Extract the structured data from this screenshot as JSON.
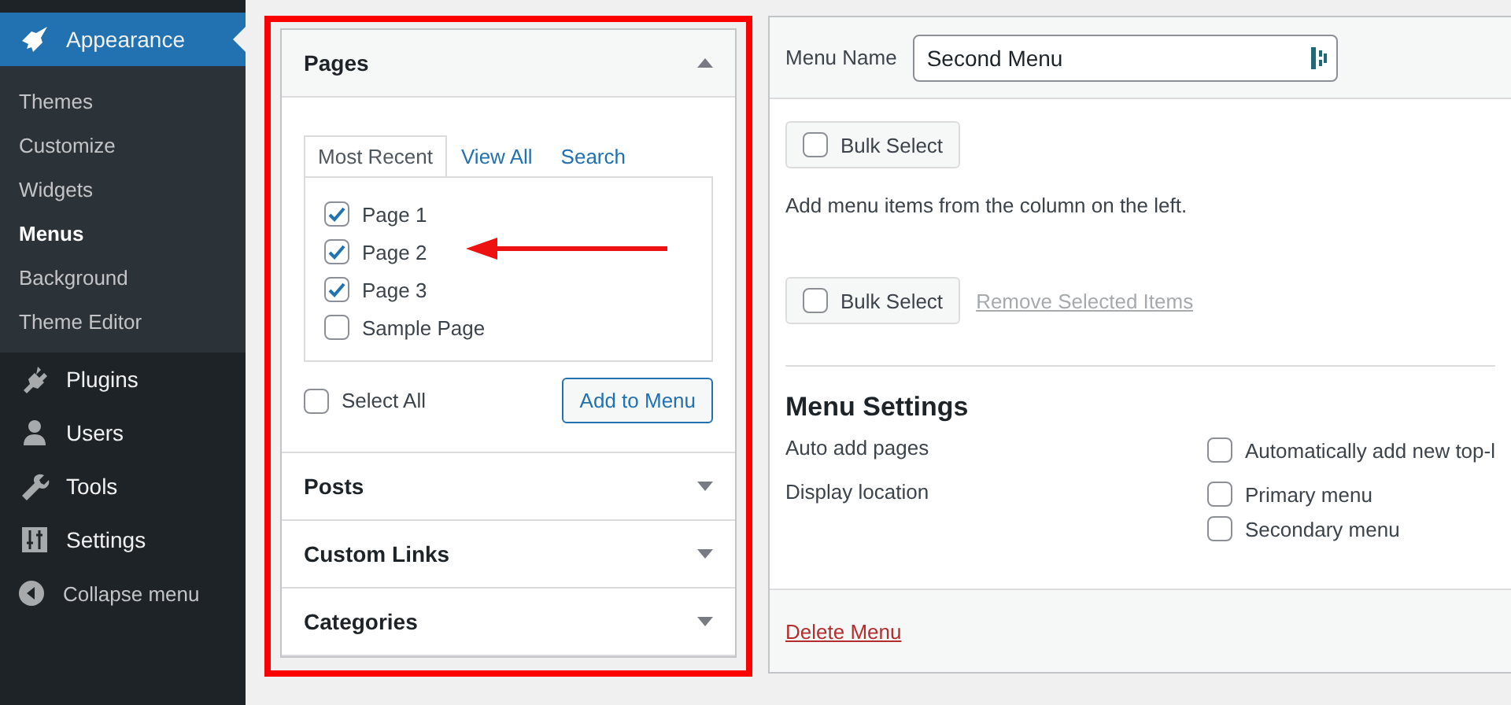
{
  "sidebar": {
    "items": [
      {
        "label": "Appearance",
        "selected": true,
        "children": [
          {
            "label": "Themes",
            "selected": false
          },
          {
            "label": "Customize",
            "selected": false
          },
          {
            "label": "Widgets",
            "selected": false
          },
          {
            "label": "Menus",
            "selected": true
          },
          {
            "label": "Background",
            "selected": false
          },
          {
            "label": "Theme Editor",
            "selected": false
          }
        ]
      },
      {
        "label": "Plugins",
        "selected": false
      },
      {
        "label": "Users",
        "selected": false
      },
      {
        "label": "Tools",
        "selected": false
      },
      {
        "label": "Settings",
        "selected": false
      }
    ],
    "collapse_label": "Collapse menu"
  },
  "sections": [
    {
      "title": "Pages",
      "expanded": true,
      "tabs": [
        {
          "label": "Most Recent",
          "selected": true
        },
        {
          "label": "View All",
          "selected": false
        },
        {
          "label": "Search",
          "selected": false
        }
      ],
      "items": [
        {
          "label": "Page 1",
          "checked": true
        },
        {
          "label": "Page 2",
          "checked": true
        },
        {
          "label": "Page 3",
          "checked": true
        },
        {
          "label": "Sample Page",
          "checked": false
        }
      ],
      "select_all": {
        "label": "Select All",
        "checked": false
      },
      "add_button": "Add to Menu"
    },
    {
      "title": "Posts",
      "expanded": false
    },
    {
      "title": "Custom Links",
      "expanded": false
    },
    {
      "title": "Categories",
      "expanded": false
    }
  ],
  "menu_editor": {
    "name_label": "Menu Name",
    "name_value": "Second Menu",
    "bulk_select_top": {
      "label": "Bulk Select",
      "checked": false
    },
    "empty_message": "Add menu items from the column on the left.",
    "bulk_select_bottom": {
      "label": "Bulk Select",
      "checked": false
    },
    "remove_link": "Remove Selected Items",
    "settings": {
      "title": "Menu Settings",
      "rows": [
        {
          "label": "Auto add pages",
          "options": [
            {
              "label": "Automatically add new top-l",
              "checked": false
            }
          ]
        },
        {
          "label": "Display location",
          "options": [
            {
              "label": "Primary menu",
              "checked": false
            },
            {
              "label": "Secondary menu",
              "checked": false
            }
          ]
        }
      ]
    },
    "delete_link": "Delete Menu"
  }
}
